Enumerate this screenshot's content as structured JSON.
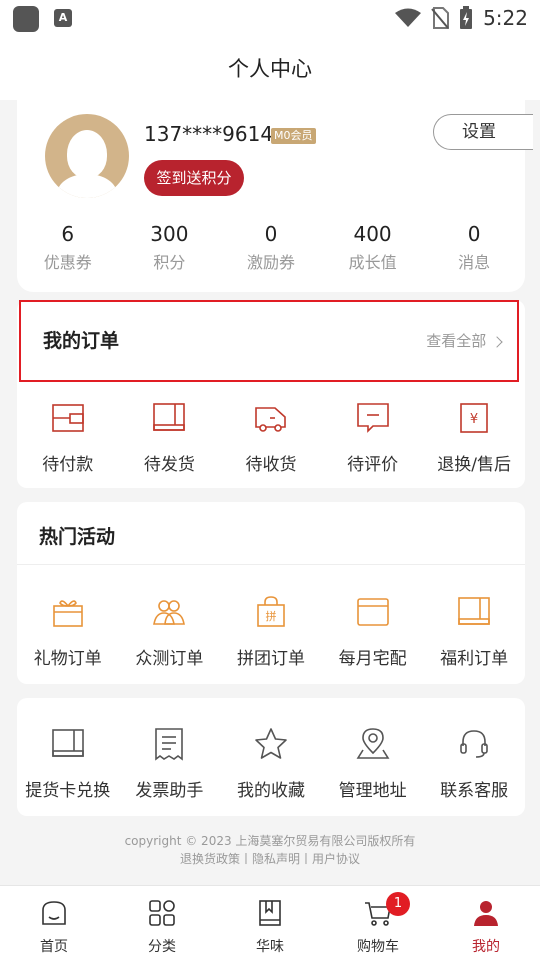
{
  "status_bar": {
    "time": "5:22"
  },
  "header": {
    "title": "个人中心"
  },
  "profile": {
    "phone": "137****9614",
    "member_level": "M0会员",
    "checkin_label": "签到送积分",
    "settings_label": "设置",
    "stats": [
      {
        "value": "6",
        "label": "优惠券"
      },
      {
        "value": "300",
        "label": "积分"
      },
      {
        "value": "0",
        "label": "激励券"
      },
      {
        "value": "400",
        "label": "成长值"
      },
      {
        "value": "0",
        "label": "消息"
      }
    ]
  },
  "orders": {
    "title": "我的订单",
    "view_all": "查看全部",
    "items": [
      {
        "label": "待付款",
        "icon": "wallet-icon"
      },
      {
        "label": "待发货",
        "icon": "package-icon"
      },
      {
        "label": "待收货",
        "icon": "truck-icon"
      },
      {
        "label": "待评价",
        "icon": "comment-icon"
      },
      {
        "label": "退换/售后",
        "icon": "refund-icon"
      }
    ]
  },
  "hot_activities": {
    "title": "热门活动",
    "items": [
      {
        "label": "礼物订单",
        "icon": "gift-icon"
      },
      {
        "label": "众测订单",
        "icon": "group-icon"
      },
      {
        "label": "拼团订单",
        "icon": "bag-icon"
      },
      {
        "label": "每月宅配",
        "icon": "calendar-box-icon"
      },
      {
        "label": "福利订单",
        "icon": "welfare-box-icon"
      }
    ]
  },
  "tools": {
    "items": [
      {
        "label": "提货卡兑换",
        "icon": "card-icon"
      },
      {
        "label": "发票助手",
        "icon": "invoice-icon"
      },
      {
        "label": "我的收藏",
        "icon": "star-icon"
      },
      {
        "label": "管理地址",
        "icon": "location-icon"
      },
      {
        "label": "联系客服",
        "icon": "headset-icon"
      }
    ]
  },
  "footer": {
    "copyright": "copyright © 2023 上海莫塞尔贸易有限公司版权所有",
    "links": "退换货政策丨隐私声明丨用户协议"
  },
  "tabbar": {
    "items": [
      {
        "label": "首页",
        "icon": "home-icon"
      },
      {
        "label": "分类",
        "icon": "category-icon"
      },
      {
        "label": "华味",
        "icon": "book-icon"
      },
      {
        "label": "购物车",
        "icon": "cart-icon",
        "badge": "1"
      },
      {
        "label": "我的",
        "icon": "user-icon",
        "active": true
      }
    ]
  },
  "colors": {
    "brand_red": "#b8232e",
    "orange_icon": "#e8943a",
    "red_icon": "#c0392b"
  }
}
